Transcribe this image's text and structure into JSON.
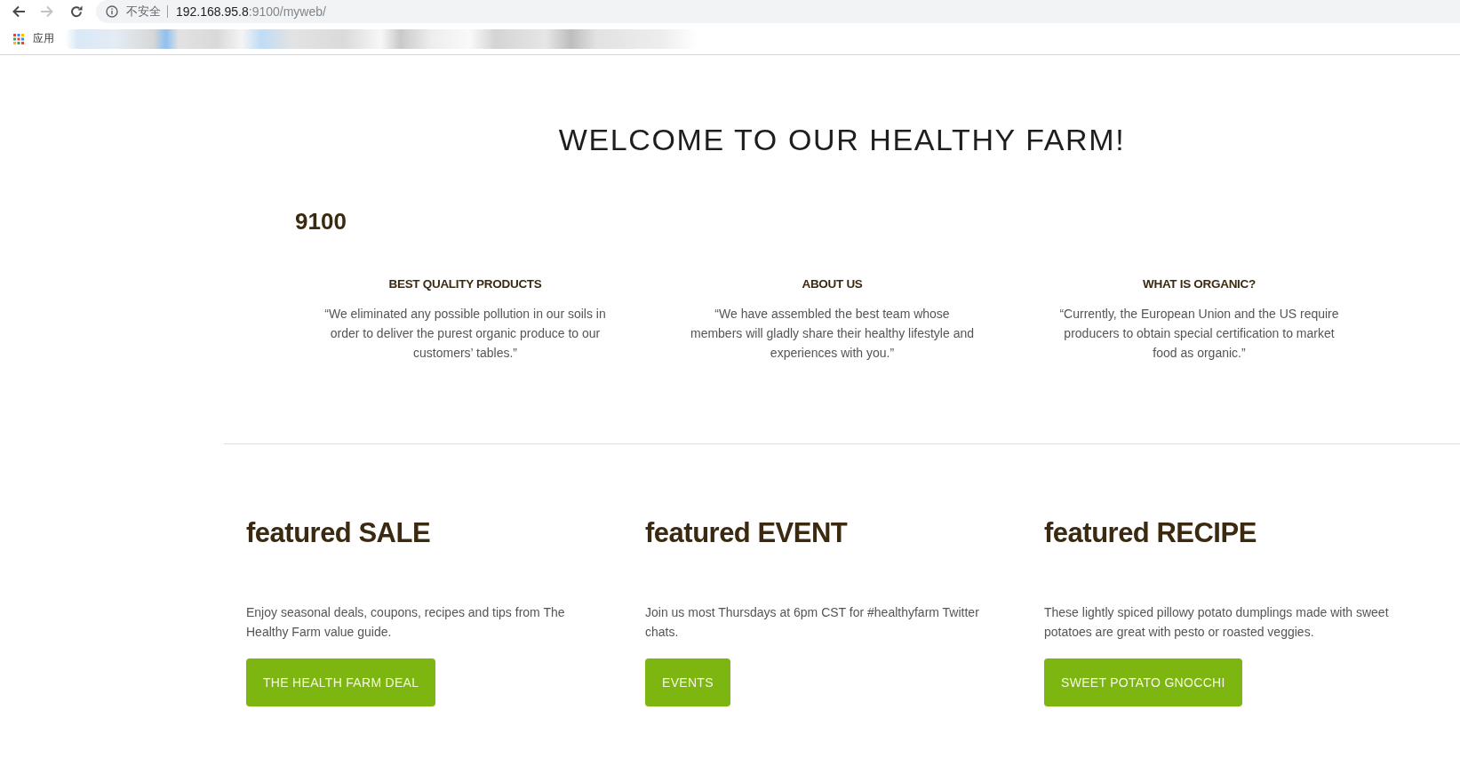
{
  "browser": {
    "nav": [
      {
        "kind": "back",
        "disabled": false
      },
      {
        "kind": "forward",
        "disabled": true
      },
      {
        "kind": "reload",
        "disabled": false
      }
    ],
    "security_label": "不安全",
    "url": {
      "host": "192.168.95.8",
      "path": ":9100/myweb/"
    },
    "apps_label": "应用"
  },
  "page": {
    "title": "WELCOME TO OUR HEALTHY FARM!",
    "port_label": "9100",
    "intro": [
      {
        "heading": "BEST QUALITY PRODUCTS",
        "text": "“We eliminated any possible pollution in our soils in order to deliver the purest organic produce to our customers’ tables.”"
      },
      {
        "heading": "ABOUT US",
        "text": "“We have assembled the best team whose members will gladly share their healthy lifestyle and experiences with you.”"
      },
      {
        "heading": "WHAT IS ORGANIC?",
        "text": "“Currently, the European Union and the US require producers to obtain special certification to market food as organic.”"
      }
    ],
    "featured": [
      {
        "heading": "featured SALE",
        "text": "Enjoy seasonal deals, coupons, recipes and tips from The Healthy Farm value guide.",
        "button": "THE HEALTH FARM DEAL"
      },
      {
        "heading": "featured EVENT",
        "text": "Join us most Thursdays at 6pm CST for #healthyfarm Twitter chats.",
        "button": "EVENTS"
      },
      {
        "heading": "featured RECIPE",
        "text": "These lightly spiced pillowy potato dumplings made with sweet potatoes are great with pesto or roasted veggies.",
        "button": "SWEET POTATO GNOCCHI"
      }
    ]
  }
}
